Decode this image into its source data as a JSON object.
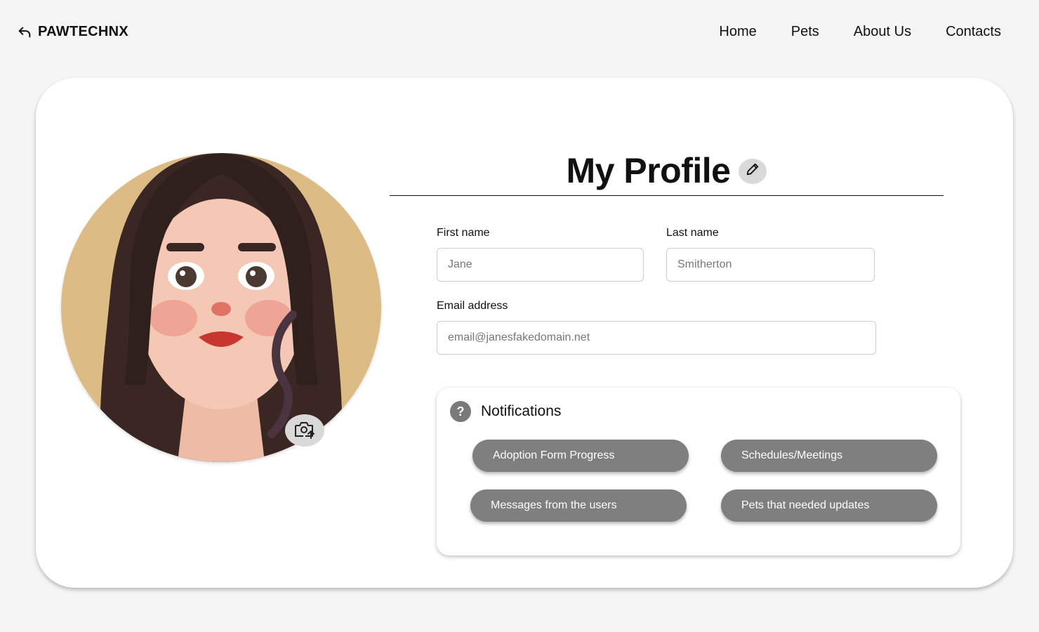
{
  "header": {
    "brand": "PAWTECHNX",
    "nav": [
      "Home",
      "Pets",
      "About Us",
      "Contacts"
    ]
  },
  "profile": {
    "title": "My Profile",
    "first_name_label": "First name",
    "first_name_placeholder": "Jane",
    "last_name_label": "Last name",
    "last_name_placeholder": "Smitherton",
    "email_label": "Email address",
    "email_placeholder": "email@janesfakedomain.net"
  },
  "notifications": {
    "title": "Notifications",
    "items": [
      "Adoption Form Progress",
      "Schedules/Meetings",
      "Messages from the users",
      "Pets that needed updates"
    ]
  },
  "icons": {
    "back": "back-arrow-icon",
    "edit": "pencil-icon",
    "camera": "camera-upload-icon",
    "help": "question-icon"
  },
  "colors": {
    "page_bg": "#f5f5f5",
    "card_bg": "#ffffff",
    "pill_bg": "#7f7f7f",
    "avatar_bg": "#dcbb84",
    "icon_bg": "#d9d9d9"
  }
}
